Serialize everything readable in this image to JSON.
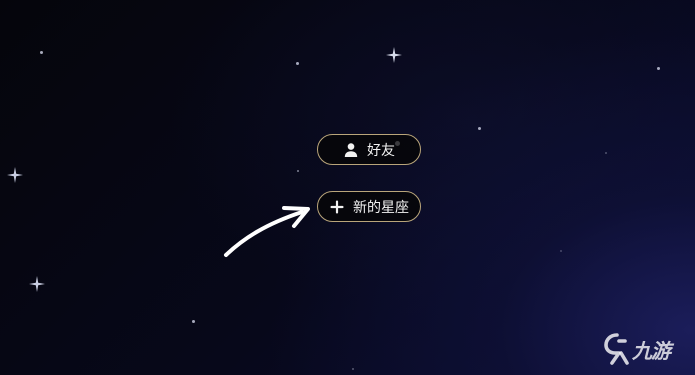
{
  "menu": {
    "friends_label": "好友",
    "new_constellation_label": "新的星座"
  },
  "watermark": {
    "text": "九游",
    "icon": "jiuyou-logo-icon"
  },
  "icons": {
    "friends": "person-icon",
    "new_constellation": "plus-icon",
    "pointer": "curved-arrow-icon",
    "sparkle": "sparkle-star-icon"
  },
  "colors": {
    "pill_border": "#b9a57a",
    "pill_background": "#06060a",
    "text": "#f2f2f2",
    "sky_dark": "#05050b",
    "sky_blue": "#1c1e5c"
  }
}
